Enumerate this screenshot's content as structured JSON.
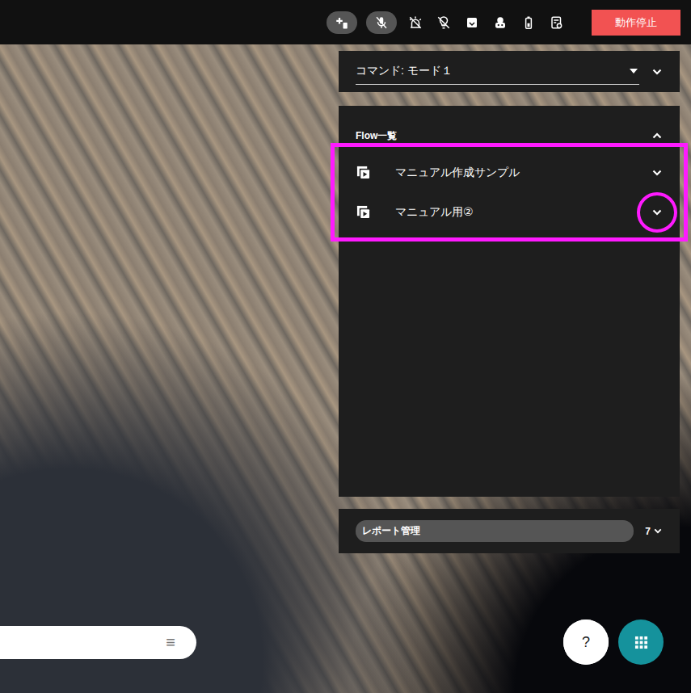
{
  "toolbar": {
    "tools": [
      {
        "kind": "add",
        "pill": true
      },
      {
        "kind": "mic-off",
        "pill": true
      },
      {
        "kind": "alarm-off",
        "pill": false
      },
      {
        "kind": "bulb-off",
        "pill": false
      },
      {
        "kind": "box",
        "pill": false
      },
      {
        "kind": "robot",
        "pill": false
      },
      {
        "kind": "battery",
        "pill": false
      },
      {
        "kind": "report",
        "pill": false
      }
    ],
    "stop_button": "動作停止"
  },
  "command": {
    "label": "コマンド: モード１",
    "expanded": false
  },
  "flow_panel": {
    "title": "Flow一覧",
    "expanded": true,
    "highlighted": true,
    "flows": [
      {
        "name": "マニュアル作成サンプル",
        "expanded": false,
        "circled": false
      },
      {
        "name": "マニュアル用②",
        "expanded": false,
        "circled": true
      }
    ]
  },
  "report": {
    "label": "レポート管理",
    "count": "7",
    "expanded": false
  },
  "bottom_bar": {
    "menu_icon": "≡"
  },
  "help_button": "?"
}
